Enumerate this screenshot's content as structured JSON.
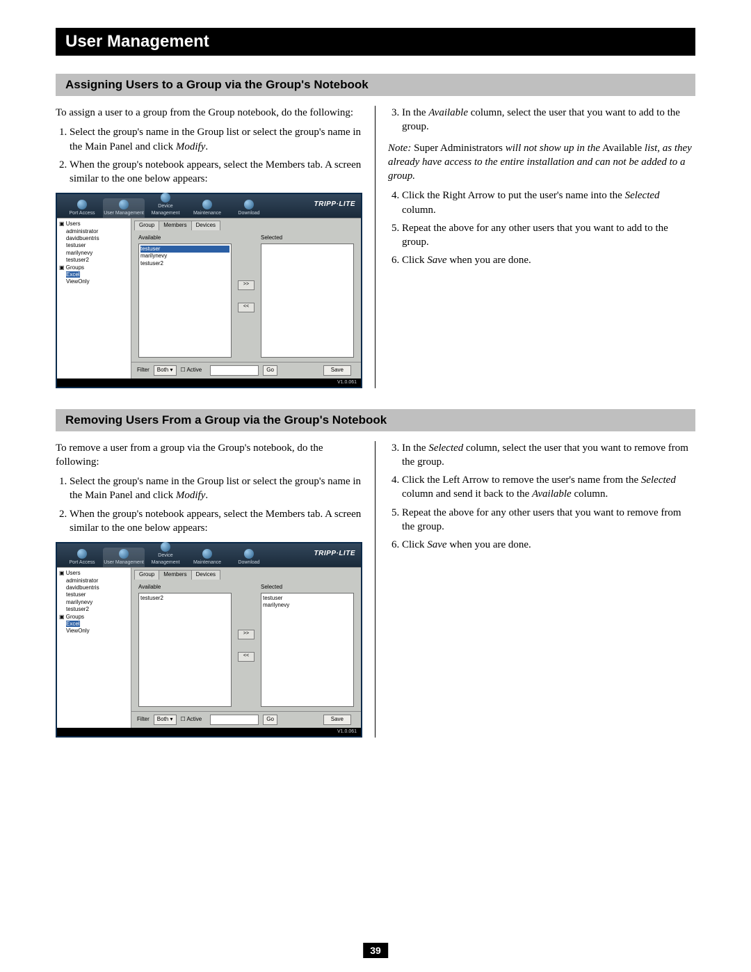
{
  "chapter_title": "User Management",
  "page_number": "39",
  "section_assign": {
    "heading": "Assigning Users to a Group via the Group's Notebook",
    "intro": "To assign a user to a group from the Group notebook, do the following:",
    "left_steps": [
      "Select the group's name in the Group list or select the group's name in the Main Panel and click Modify.",
      "When the group's notebook appears, select the Members tab. A screen similar to the one below appears:"
    ],
    "right_step_3": "In the Available column, select the user that you want to add to the group.",
    "note_prefix": "Note:",
    "note_text_a": "Super Administrators",
    "note_text_b": "will not show up in the",
    "note_text_c": "Available",
    "note_text_d": "list, as they already have access to the entire installation and can not be added to a group.",
    "right_step_4": "Click the Right Arrow to put the user's name into the Selected column.",
    "right_step_5": "Repeat the above for any other users that you want to add to the group.",
    "right_step_6": "Click Save when you are done."
  },
  "section_remove": {
    "heading": "Removing Users From a Group via the Group's Notebook",
    "intro": "To remove a user from a group via the Group's notebook, do the following:",
    "left_steps": [
      "Select the group's name in the Group list or select the group's name in the Main Panel and click Modify.",
      "When the group's notebook appears, select the Members tab. A screen similar to the one below appears:"
    ],
    "right_step_3": "In the Selected column, select the user that you want to remove from the group.",
    "right_step_4": "Click the Left Arrow to remove the user's name from the Selected column and send it back to the Available column.",
    "right_step_5": "Repeat the above for any other users that you want to remove from the group.",
    "right_step_6": "Click Save when you are done."
  },
  "screenshot_common": {
    "brand": "TRIPP·LITE",
    "version": "V1.0.061",
    "toolbar": [
      "Port Access",
      "User Management",
      "Device Management",
      "Maintenance",
      "Download"
    ],
    "tabs": [
      "Group",
      "Members",
      "Devices"
    ],
    "tree": {
      "users_label": "Users",
      "users": [
        "administrator",
        "davidbuentris",
        "testuser",
        "marilynevy",
        "testuser2"
      ],
      "groups_label": "Groups",
      "groups_sel": "Excel",
      "groups_other": "ViewOnly"
    },
    "filter_label": "Filter",
    "filter_select": "Both",
    "active_label": "Active",
    "go_label": "Go",
    "save_label": "Save",
    "available_label": "Available",
    "selected_label": "Selected",
    "arrow_right": ">>",
    "arrow_left": "<<"
  },
  "screenshot_assign": {
    "available": [
      "testuser",
      "marilynevy",
      "testuser2"
    ],
    "available_selected_index": 0,
    "selected": []
  },
  "screenshot_remove": {
    "available": [
      "testuser2"
    ],
    "selected": [
      "testuser",
      "marilynevy"
    ]
  }
}
